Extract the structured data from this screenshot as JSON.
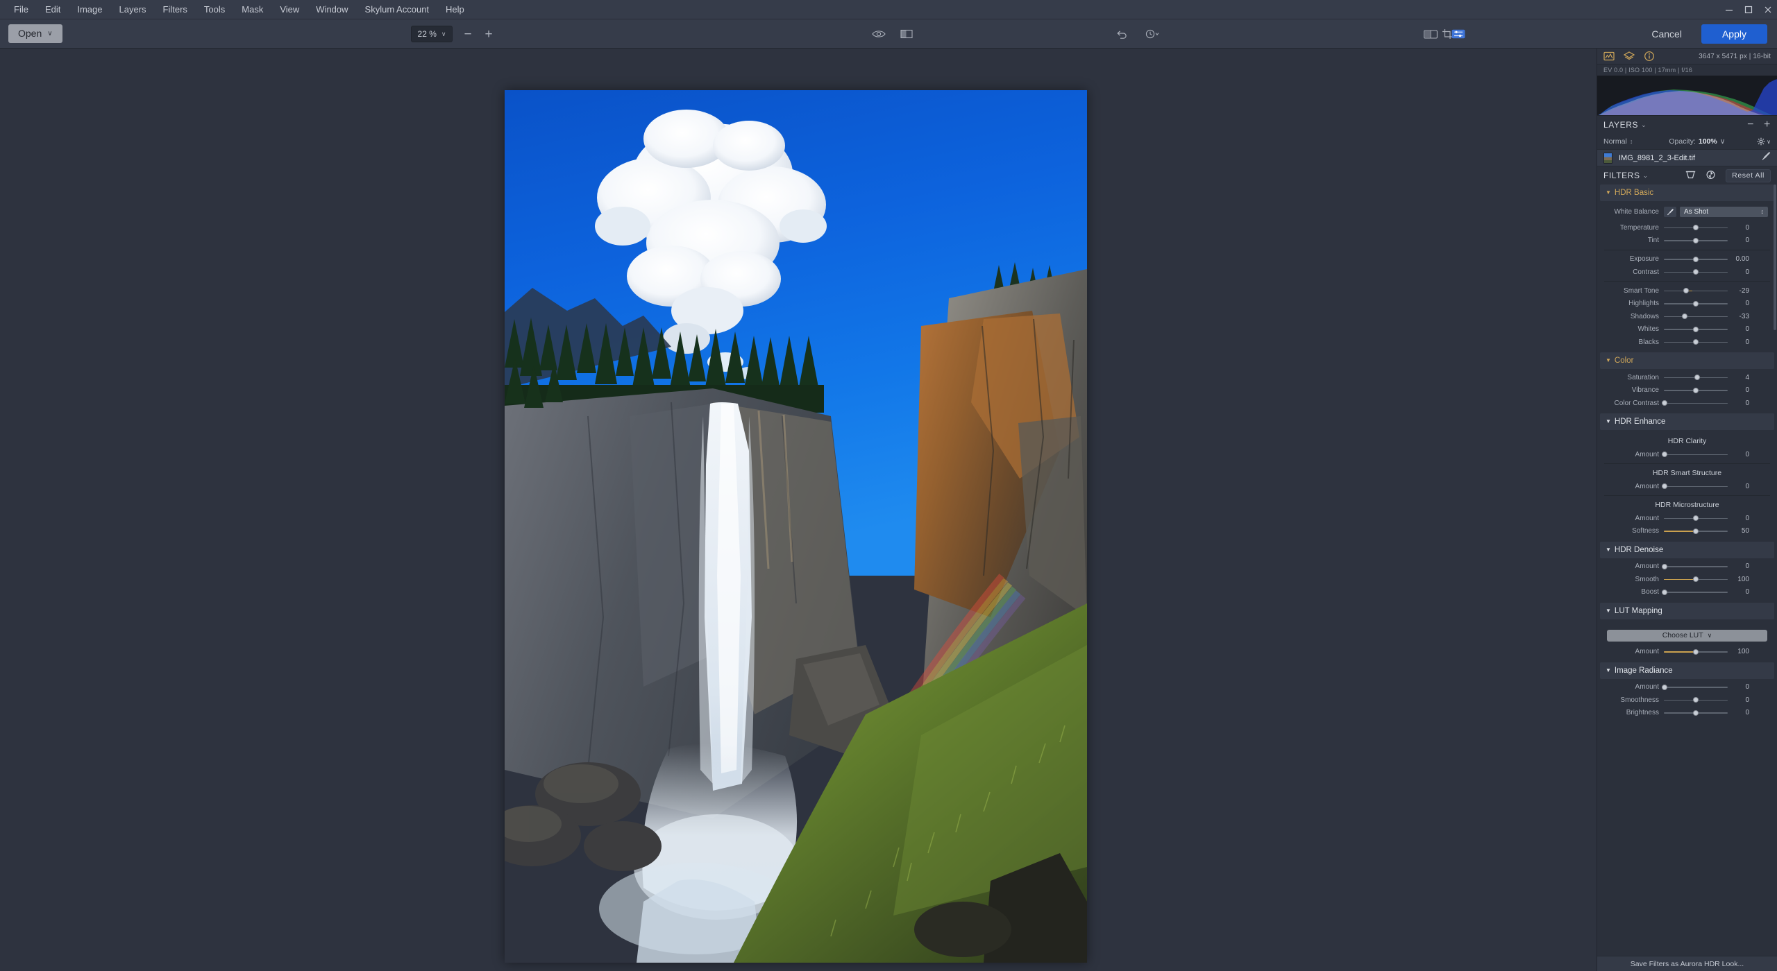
{
  "window": {
    "minimize_label": "minimize",
    "maximize_label": "maximize",
    "close_label": "close"
  },
  "menu": {
    "items": [
      {
        "label": "File"
      },
      {
        "label": "Edit"
      },
      {
        "label": "Image"
      },
      {
        "label": "Layers"
      },
      {
        "label": "Filters"
      },
      {
        "label": "Tools"
      },
      {
        "label": "Mask"
      },
      {
        "label": "View"
      },
      {
        "label": "Window"
      },
      {
        "label": "Skylum Account"
      },
      {
        "label": "Help"
      }
    ]
  },
  "toolbar": {
    "open_label": "Open",
    "open_chevron": "∨",
    "zoom_value": "22 %",
    "zoom_chevron": "∨",
    "zoom_out": "−",
    "zoom_in": "+",
    "icons": {
      "preview_eye": "preview-eye-icon",
      "compare": "compare-split-icon",
      "undo": "undo-icon",
      "history": "history-clock-icon",
      "crop": "crop-icon",
      "before_after": "before-after-icon",
      "adjust": "adjust-sliders-icon"
    },
    "cancel_label": "Cancel",
    "apply_label": "Apply"
  },
  "info": {
    "icons": [
      "histogram-icon",
      "layers-stack-icon",
      "info-circle-icon"
    ],
    "dimensions": "3647 x 5471 px  |  16-bit",
    "exif": "EV 0.0  |  ISO 100  |  17mm  |  f/16"
  },
  "layers": {
    "title": "LAYERS",
    "chevron": "⌄",
    "remove_label": "−",
    "add_label": "+",
    "blend_mode": "Normal",
    "blend_updown": "↕",
    "opacity_label": "Opacity:",
    "opacity_value": "100%",
    "opacity_chevron": "∨",
    "gear_chevron": "∨",
    "items": [
      {
        "name": "IMG_8981_2_3-Edit.tif"
      }
    ]
  },
  "filters": {
    "title": "FILTERS",
    "chevron": "⌄",
    "reset_all_label": "Reset All",
    "groups": [
      {
        "id": "hdr_basic",
        "title": "HDR Basic",
        "accent": true,
        "white_balance": {
          "label": "White Balance",
          "value": "As Shot",
          "picker_icon": "eyedropper-icon",
          "updown": "↕"
        },
        "sliders": [
          {
            "label": "Temperature",
            "value": "0",
            "pos": 50,
            "grad": "grad-temp"
          },
          {
            "label": "Tint",
            "value": "0",
            "pos": 50,
            "grad": "grad-tint"
          },
          {
            "label": "Exposure",
            "value": "0.00",
            "pos": 50,
            "grad": ""
          },
          {
            "label": "Contrast",
            "value": "0",
            "pos": 50,
            "grad": ""
          },
          {
            "label": "Smart Tone",
            "value": "-29",
            "pos": 35,
            "grad": "grad-gold"
          },
          {
            "label": "Highlights",
            "value": "0",
            "pos": 50,
            "grad": ""
          },
          {
            "label": "Shadows",
            "value": "-33",
            "pos": 33,
            "grad": ""
          },
          {
            "label": "Whites",
            "value": "0",
            "pos": 50,
            "grad": ""
          },
          {
            "label": "Blacks",
            "value": "0",
            "pos": 50,
            "grad": ""
          }
        ]
      },
      {
        "id": "color",
        "title": "Color",
        "accent": true,
        "sliders": [
          {
            "label": "Saturation",
            "value": "4",
            "pos": 52,
            "grad": "grad-sat"
          },
          {
            "label": "Vibrance",
            "value": "0",
            "pos": 50,
            "grad": "grad-sat"
          },
          {
            "label": "Color Contrast",
            "value": "0",
            "pos": 0,
            "grad": ""
          }
        ]
      },
      {
        "id": "hdr_enhance",
        "title": "HDR Enhance",
        "accent": false,
        "subsections": [
          {
            "title": "HDR Clarity",
            "sliders": [
              {
                "label": "Amount",
                "value": "0",
                "pos": 0,
                "grad": ""
              }
            ]
          },
          {
            "title": "HDR Smart Structure",
            "sliders": [
              {
                "label": "Amount",
                "value": "0",
                "pos": 0,
                "grad": ""
              }
            ]
          },
          {
            "title": "HDR Microstructure",
            "sliders": [
              {
                "label": "Amount",
                "value": "0",
                "pos": 50,
                "grad": ""
              },
              {
                "label": "Softness",
                "value": "50",
                "pos": 50,
                "grad": "grad-gold"
              }
            ]
          }
        ]
      },
      {
        "id": "hdr_denoise",
        "title": "HDR Denoise",
        "accent": false,
        "sliders": [
          {
            "label": "Amount",
            "value": "0",
            "pos": 0,
            "grad": ""
          },
          {
            "label": "Smooth",
            "value": "100",
            "pos": 50,
            "grad": "grad-gold"
          },
          {
            "label": "Boost",
            "value": "0",
            "pos": 0,
            "grad": ""
          }
        ]
      },
      {
        "id": "lut_mapping",
        "title": "LUT Mapping",
        "accent": false,
        "choose_lut_label": "Choose LUT",
        "choose_lut_chevron": "∨",
        "sliders": [
          {
            "label": "Amount",
            "value": "100",
            "pos": 50,
            "grad": "grad-gold"
          }
        ]
      },
      {
        "id": "image_radiance",
        "title": "Image Radiance",
        "accent": false,
        "sliders": [
          {
            "label": "Amount",
            "value": "0",
            "pos": 0,
            "grad": ""
          },
          {
            "label": "Smoothness",
            "value": "0",
            "pos": 50,
            "grad": ""
          },
          {
            "label": "Brightness",
            "value": "0",
            "pos": 50,
            "grad": ""
          }
        ]
      }
    ],
    "footer_label": "Save Filters as Aurora HDR Look..."
  },
  "photo": {
    "alt": "Vernal Fall waterfall in Yosemite with rainbow, cumulus cloud over blue sky"
  },
  "colors": {
    "accent_gold": "#d1a85a",
    "apply_blue": "#1f5fd0",
    "panel_bg": "#2b303b",
    "chrome_bg": "#363c4a",
    "canvas_bg": "#2e333f"
  }
}
